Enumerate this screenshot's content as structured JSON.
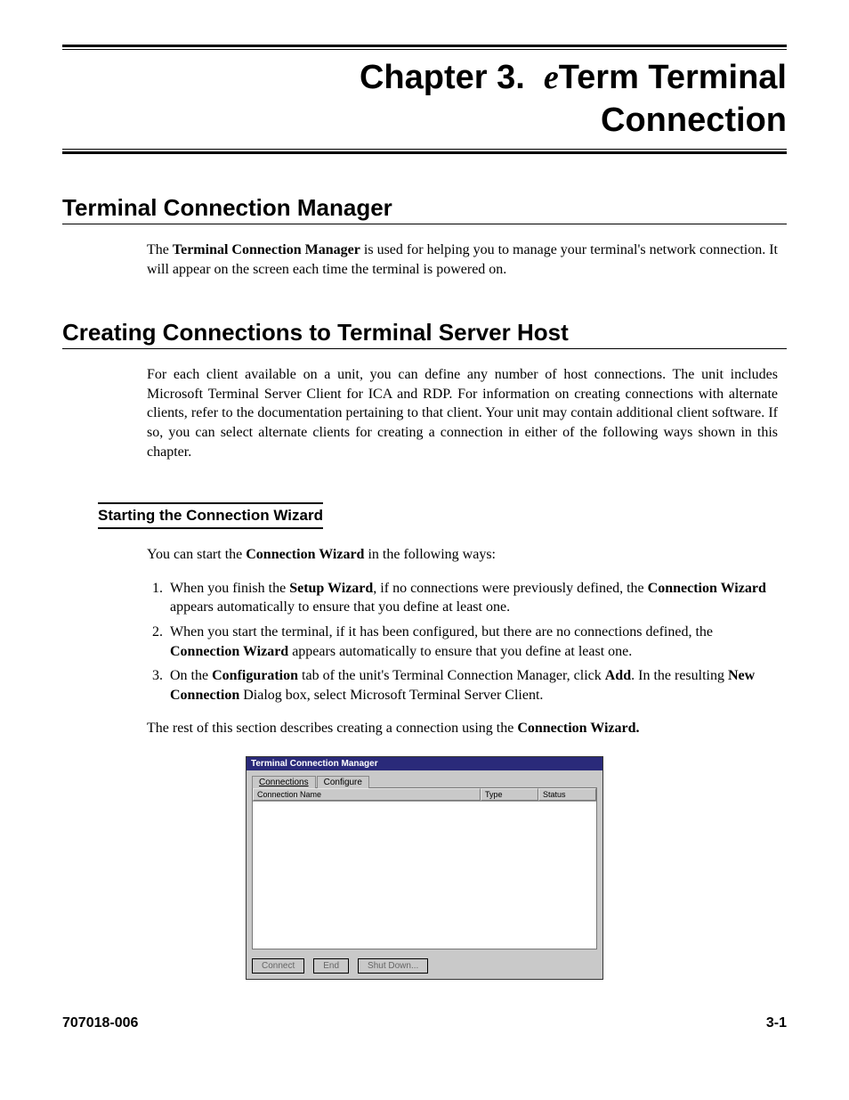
{
  "chapter": {
    "label": "Chapter 3.",
    "title_line1_prefix": "e",
    "title_line1_rest": "Term Terminal",
    "title_line2": "Connection"
  },
  "section1": {
    "heading": "Terminal Connection Manager",
    "p1_a": "The ",
    "p1_b": "Terminal Connection Manager",
    "p1_c": " is used for helping you to manage your terminal's network connection. It will appear on the screen each time the terminal is powered on."
  },
  "section2": {
    "heading": "Creating Connections to Terminal Server Host",
    "p1": "For each client available on a unit, you can define any number of host connections. The unit includes Microsoft Terminal Server Client for ICA and RDP. For information on creating connections with alternate clients, refer to the documentation pertaining to that client. Your unit may contain additional client software. If so, you can select alternate clients for creating a connection in either of the following ways shown in this chapter."
  },
  "subsection": {
    "heading": "Starting the Connection Wizard",
    "intro_a": "You can start the ",
    "intro_b": "Connection Wizard",
    "intro_c": " in the following ways:",
    "li1_a": "When you finish the ",
    "li1_b": "Setup Wizard",
    "li1_c": ", if no connections were previously defined, the ",
    "li1_d": "Connection Wizard",
    "li1_e": " appears automatically to ensure that you define at least one.",
    "li2_a": "When you start the terminal, if it has been configured, but there are no connections defined, the ",
    "li2_b": "Connection Wizard",
    "li2_c": " appears automatically to ensure that you define at least one.",
    "li3_a": "On the ",
    "li3_b": "Configuration",
    "li3_c": " tab of the unit's Terminal Connection Manager, click ",
    "li3_d": "Add",
    "li3_e": ". In the resulting ",
    "li3_f": "New Connection",
    "li3_g": " Dialog box, select Microsoft Terminal Server Client.",
    "closing_a": "The rest of this section describes creating a connection using the ",
    "closing_b": "Connection Wizard."
  },
  "window": {
    "title": "Terminal Connection Manager",
    "tab1": "Connections",
    "tab2": "Configure",
    "col_name": "Connection Name",
    "col_type": "Type",
    "col_status": "Status",
    "btn_connect": "Connect",
    "btn_end": "End",
    "btn_shutdown": "Shut Down..."
  },
  "footer": {
    "left": "707018-006",
    "right": "3-1"
  }
}
